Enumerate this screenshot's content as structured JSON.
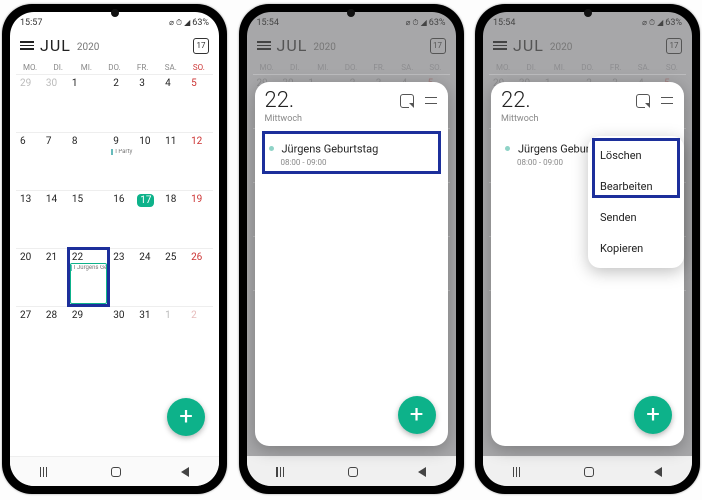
{
  "status": {
    "time1": "15:57",
    "time2": "15:54",
    "time3": "15:54",
    "battery": "63%",
    "icons": "⌀ ⏱ ◢"
  },
  "header": {
    "month": "JUL",
    "year": "2020",
    "today_num": "17"
  },
  "weekdays": [
    "MO.",
    "DI.",
    "MI.",
    "DO.",
    "FR.",
    "SA.",
    "SO."
  ],
  "rows": [
    [
      {
        "n": "29",
        "faded": true
      },
      {
        "n": "30",
        "faded": true
      },
      {
        "n": "1"
      },
      {
        "n": "2"
      },
      {
        "n": "3"
      },
      {
        "n": "4"
      },
      {
        "n": "5",
        "sun": true
      }
    ],
    [
      {
        "n": "6"
      },
      {
        "n": "7"
      },
      {
        "n": "8"
      },
      {
        "n": "9",
        "chip": "I Party"
      },
      {
        "n": "10"
      },
      {
        "n": "11"
      },
      {
        "n": "12",
        "sun": true
      }
    ],
    [
      {
        "n": "13"
      },
      {
        "n": "14"
      },
      {
        "n": "15"
      },
      {
        "n": "16"
      },
      {
        "n": "17",
        "today": true
      },
      {
        "n": "18"
      },
      {
        "n": "19",
        "sun": true
      }
    ],
    [
      {
        "n": "20"
      },
      {
        "n": "21"
      },
      {
        "n": "22",
        "chip": "I Jürgens Ge",
        "hl": true,
        "sel": true
      },
      {
        "n": "23"
      },
      {
        "n": "24"
      },
      {
        "n": "25"
      },
      {
        "n": "26",
        "sun": true
      }
    ],
    [
      {
        "n": "27"
      },
      {
        "n": "28"
      },
      {
        "n": "29"
      },
      {
        "n": "30"
      },
      {
        "n": "31"
      },
      {
        "n": "1",
        "faded": true
      },
      {
        "n": "2",
        "faded": true,
        "sun": true
      }
    ]
  ],
  "panel": {
    "date": "22.",
    "day": "Mittwoch",
    "event_title": "Jürgens Geburtstag",
    "event_time": "08:00 - 09:00"
  },
  "ctx": {
    "delete": "Löschen",
    "edit": "Bearbeiten",
    "send": "Senden",
    "copy": "Kopieren"
  },
  "fab": "+"
}
